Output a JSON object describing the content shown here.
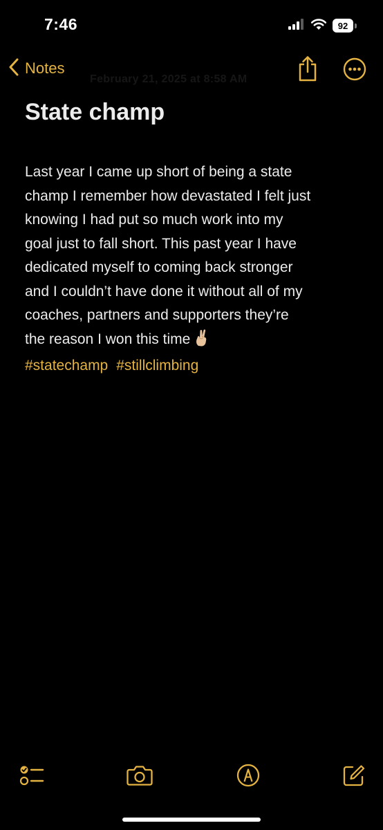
{
  "status_bar": {
    "time": "7:46",
    "battery_level": "92",
    "signal_icon": "cellular-signal-icon",
    "wifi_icon": "wifi-icon"
  },
  "nav": {
    "back_label": "Notes",
    "date_text": "February 21, 2025 at 8:58 AM",
    "back_icon": "chevron-left-icon",
    "share_icon": "share-icon",
    "more_icon": "ellipsis-circle-icon"
  },
  "note": {
    "title": "State champ",
    "body_lines": [
      "Last year I came up short of being a state",
      "champ I remember how devastated I felt just",
      "knowing I had put so much work into my",
      "goal just to fall short. This past year I have",
      "dedicated myself to coming back stronger",
      "and I couldn’t have done it without all of my",
      "coaches, partners and supporters they’re",
      "the reason I won this time"
    ],
    "emoji": "crossed-fingers-emoji",
    "hashtags": [
      "#statechamp",
      "#stillclimbing"
    ]
  },
  "toolbar": {
    "checklist_icon": "checklist-icon",
    "camera_icon": "camera-icon",
    "markup_icon": "markup-pen-icon",
    "compose_icon": "compose-icon"
  },
  "colors": {
    "accent": "#e4b341",
    "background": "#000000",
    "text": "#ececec"
  }
}
